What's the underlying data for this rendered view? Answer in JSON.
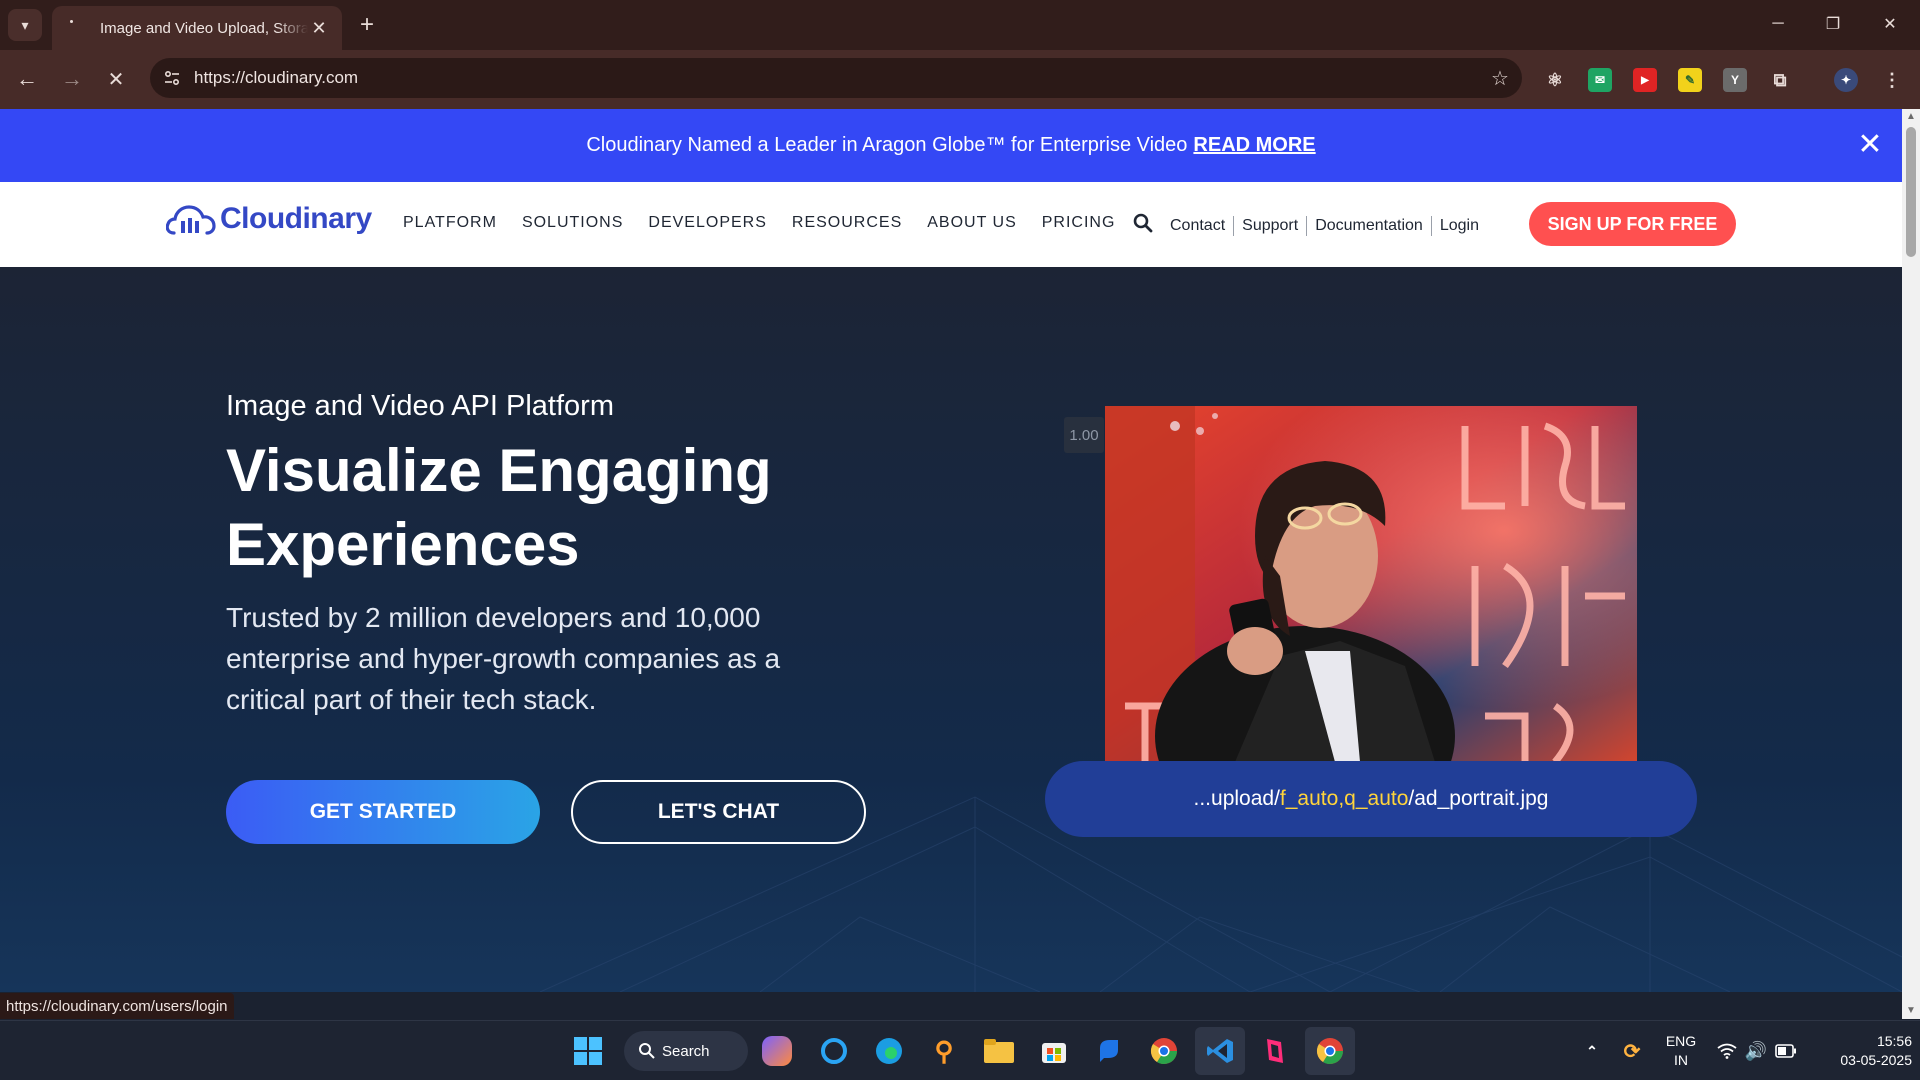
{
  "browser": {
    "tab_title": "Image and Video Upload, Storage",
    "url": "https://cloudinary.com",
    "status_url": "https://cloudinary.com/users/login"
  },
  "banner": {
    "text": "Cloudinary Named a Leader in Aragon Globe™ for Enterprise Video",
    "link": "READ MORE"
  },
  "nav": {
    "logo": "Cloudinary",
    "links": [
      "PLATFORM",
      "SOLUTIONS",
      "DEVELOPERS",
      "RESOURCES",
      "ABOUT US",
      "PRICING"
    ],
    "utility": [
      "Contact",
      "Support",
      "Documentation",
      "Login"
    ],
    "signup": "SIGN UP FOR FREE"
  },
  "hero": {
    "subtitle": "Image and Video API Platform",
    "title_line1": "Visualize Engaging",
    "title_line2": "Experiences",
    "description": "Trusted by 2 million developers and 10,000 enterprise and hyper-growth companies as a critical part of their tech stack.",
    "primary_cta": "GET STARTED",
    "secondary_cta": "LET'S CHAT",
    "zoom_label": "1.00",
    "url_prefix": "...upload/",
    "url_param1": "f_auto",
    "url_comma": ",",
    "url_param2": "q_auto",
    "url_suffix": "/ad_portrait.jpg"
  },
  "taskbar": {
    "search": "Search",
    "lang_line1": "ENG",
    "lang_line2": "IN",
    "time": "15:56",
    "date": "03-05-2025"
  },
  "colors": {
    "banner": "#3448f5",
    "brand": "#3448c5",
    "signup": "#ff5050",
    "highlight": "#ffd43b"
  }
}
